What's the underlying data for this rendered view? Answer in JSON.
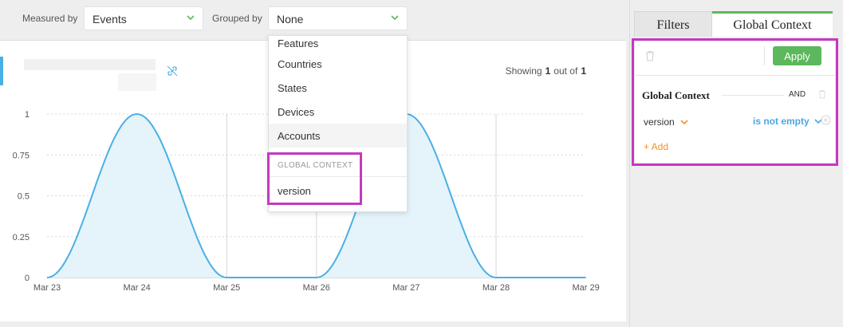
{
  "controls": {
    "measured_by_label": "Measured by",
    "measured_by_value": "Events",
    "grouped_by_label": "Grouped by",
    "grouped_by_value": "None"
  },
  "dropdown": {
    "items": [
      "Features",
      "Countries",
      "States",
      "Devices",
      "Accounts"
    ],
    "hovered": "Accounts",
    "group_header": "GLOBAL CONTEXT",
    "group_items": [
      "version"
    ]
  },
  "summary": {
    "showing_prefix": "Showing",
    "showing_count": "1",
    "out_of_label": "out of",
    "total_count": "1"
  },
  "chart_data": {
    "type": "area",
    "x": [
      "Mar 23",
      "Mar 24",
      "Mar 25",
      "Mar 26",
      "Mar 27",
      "Mar 28",
      "Mar 29"
    ],
    "series": [
      {
        "values": [
          0,
          1,
          0,
          0,
          1,
          0,
          0
        ]
      }
    ],
    "y_ticks": [
      "0",
      "0.25",
      "0.5",
      "0.75",
      "1"
    ],
    "ylim": [
      0,
      1
    ],
    "grid": true,
    "line_color": "#4ab0e4",
    "fill_color": "#e5f3fb"
  },
  "panel": {
    "tabs": [
      "Filters",
      "Global Context"
    ],
    "active_tab": "Global Context",
    "apply_label": "Apply",
    "context_title": "Global Context",
    "logic_label": "AND",
    "condition": {
      "field": "version",
      "operator": "is not empty"
    },
    "add_label": "+ Add"
  },
  "colors": {
    "accent_green": "#5cb85c",
    "accent_blue": "#4aa7e0",
    "accent_orange": "#f0922b",
    "highlight_magenta": "#c339c3"
  }
}
